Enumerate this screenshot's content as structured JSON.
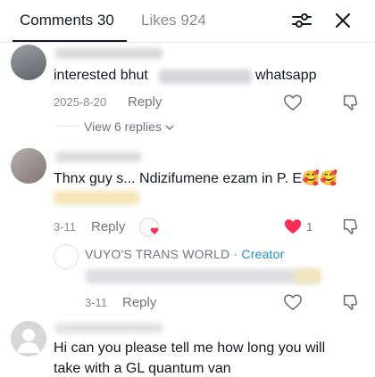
{
  "tabs": {
    "comments_label": "Comments 30",
    "likes_label": "Likes 924"
  },
  "header_icons": {
    "filter": "sliders-icon",
    "close": "close-icon"
  },
  "comments": [
    {
      "text_prefix": "interested bhut",
      "text_suffix": "whatsapp",
      "date": "2025-8-20",
      "reply_label": "Reply",
      "view_replies": "View 6 replies"
    },
    {
      "text": "Thnx guy s... Ndizifumene ezam in P. E🥰🥰",
      "date": "3-11",
      "reply_label": "Reply",
      "like_count": "1",
      "reply": {
        "author": "VUYO'S TRANS WORLD",
        "badge": " · Creator",
        "date": "3-11",
        "reply_label": "Reply"
      }
    },
    {
      "text_line1": "Hi can you please tell me how long you will",
      "text_line2": "take with a GL quantum van"
    }
  ],
  "colors": {
    "liked_heart": "#fe2c55",
    "creator_badge": "#1e8fbf",
    "muted_text": "#8a8b91"
  }
}
